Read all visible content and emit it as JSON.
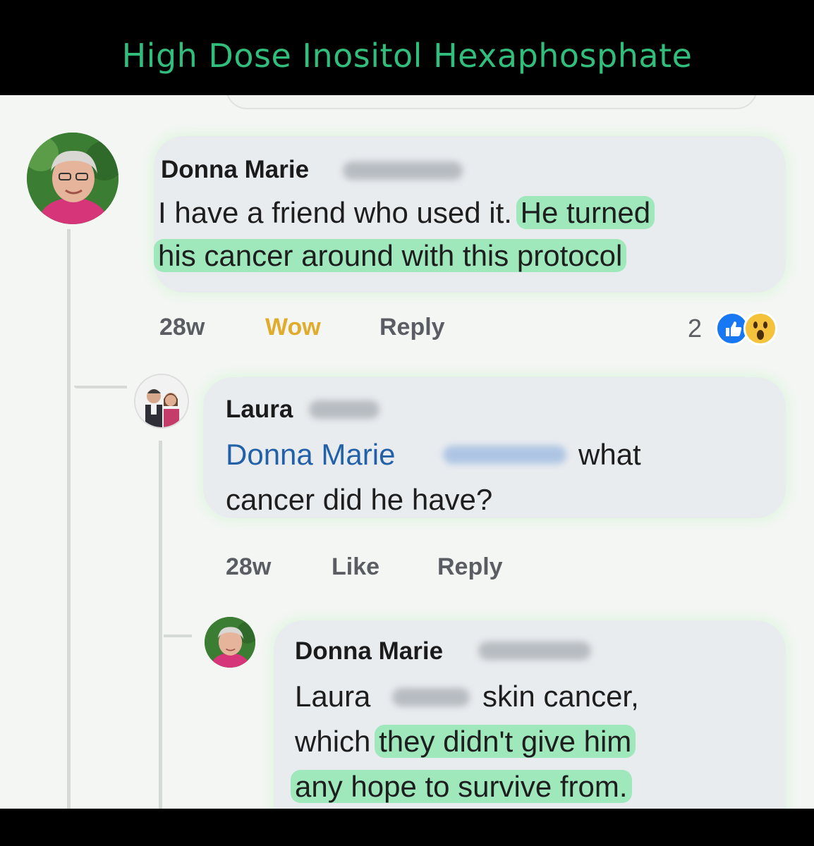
{
  "header": {
    "title": "High Dose Inositol Hexaphosphate"
  },
  "comments": [
    {
      "author": "Donna Marie",
      "lines": {
        "l1_plain": "I have a friend who used it. ",
        "l1_hl": "He turned",
        "l2_hl": "his cancer around with this protocol"
      },
      "time": "28w",
      "action": "Wow",
      "reply": "Reply",
      "reaction_count": "2",
      "reaction_icons": [
        "like-icon",
        "wow-icon"
      ]
    },
    {
      "author": "Laura",
      "mention": "Donna Marie",
      "lines": {
        "l1_after": "what",
        "l2": "cancer did he have?"
      },
      "time": "28w",
      "action": "Like",
      "reply": "Reply"
    },
    {
      "author": "Donna Marie",
      "mention": "Laura",
      "lines": {
        "l1_after": "skin cancer,",
        "l2_plain": "which ",
        "l2_hl": "they didn't give him",
        "l3_hl": "any hope to survive from."
      }
    }
  ],
  "colors": {
    "title": "#31bd7c",
    "highlight": "#78e6a0",
    "mention": "#2261a8",
    "wow": "#e1ac2b",
    "like": "#1877f2"
  }
}
